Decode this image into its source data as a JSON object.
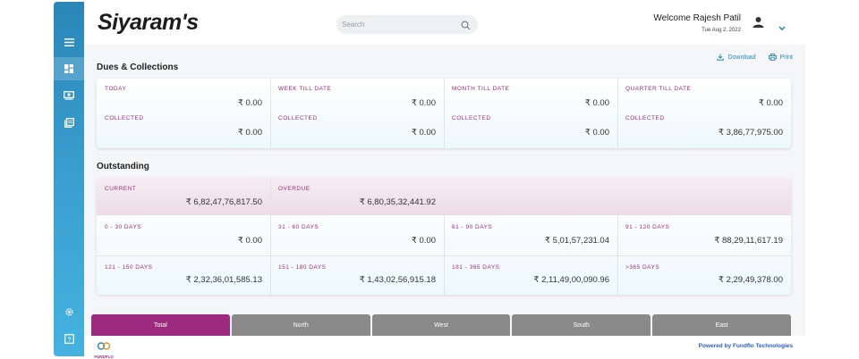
{
  "app": {
    "brand": "Siyaram's"
  },
  "header": {
    "search_placeholder": "Search",
    "welcome": "Welcome Rajesh Patil",
    "date": "Tue Aug 2, 2022"
  },
  "actions": {
    "download": "Download",
    "print": "Print"
  },
  "dues": {
    "title": "Dues & Collections",
    "columns": [
      {
        "label": "TODAY",
        "value": "₹ 0.00",
        "collected_label": "COLLECTED",
        "collected": "₹ 0.00"
      },
      {
        "label": "WEEK TILL DATE",
        "value": "₹ 0.00",
        "collected_label": "COLLECTED",
        "collected": "₹ 0.00"
      },
      {
        "label": "MONTH TILL DATE",
        "value": "₹ 0.00",
        "collected_label": "COLLECTED",
        "collected": "₹ 0.00"
      },
      {
        "label": "QUARTER TILL DATE",
        "value": "₹ 0.00",
        "collected_label": "COLLECTED",
        "collected": "₹ 3,86,77,975.00"
      }
    ]
  },
  "outstanding": {
    "title": "Outstanding",
    "current_label": "CURRENT",
    "current": "₹ 6,82,47,76,817.50",
    "overdue_label": "OVERDUE",
    "overdue": "₹ 6,80,35,32,441.92",
    "buckets": [
      {
        "label": "0 - 30 DAYS",
        "value": "₹ 0.00"
      },
      {
        "label": "31 - 60 DAYS",
        "value": "₹ 0.00"
      },
      {
        "label": "61 - 90 DAYS",
        "value": "₹ 5,01,57,231.04"
      },
      {
        "label": "91 - 120 DAYS",
        "value": "₹ 88,29,11,617.19"
      },
      {
        "label": "121 - 150 DAYS",
        "value": "₹ 2,32,36,01,585.13"
      },
      {
        "label": "151 - 180 DAYS",
        "value": "₹ 1,43,02,56,915.18"
      },
      {
        "label": "181 - 365 DAYS",
        "value": "₹ 2,11,49,00,090.96"
      },
      {
        "label": ">365 DAYS",
        "value": "₹ 2,29,49,378.00"
      }
    ]
  },
  "tabs": [
    "Total",
    "North",
    "West",
    "South",
    "East"
  ],
  "footer": {
    "logo_text": "FUNDFLO",
    "powered": "Powered by Fundflo Technologies"
  },
  "colors": {
    "accent": "#9c2a7f",
    "sidebar": "#2b86b8",
    "tab_inactive": "#8a8a8a",
    "link": "#2b86b8"
  }
}
